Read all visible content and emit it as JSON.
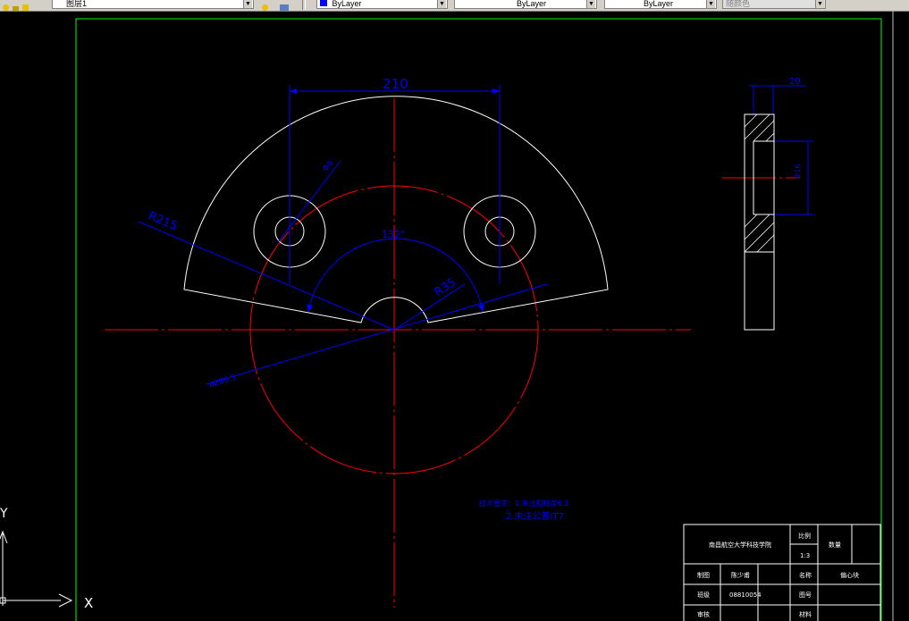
{
  "toolbar": {
    "layer_name": "图层1",
    "color_value": "ByLayer",
    "linetype_value": "ByLayer",
    "lineweight_value": "ByLayer",
    "plotstyle_value": "随颜色"
  },
  "drawing": {
    "dim_width": "210",
    "dim_hole": "Φ6",
    "dim_outer_radius": "R215",
    "dim_angle": "132°",
    "dim_inner_radius": "R35",
    "dim_dia": "ø286.5",
    "dim_side_thickness": "20",
    "dim_side_height": "Φ16",
    "tech_req_1": "技术要求：1.未注粗糙度6.3",
    "tech_req_2": "2.未注公差IT7"
  },
  "title_block": {
    "school": "南昌航空大学科技学院",
    "scale_label": "比例",
    "scale_value": "1:3",
    "qty_label": "数量",
    "drawn_label": "制图",
    "drawn_name": "陈少甫",
    "name_label": "名称",
    "part_name": "偏心块",
    "class_label": "班级",
    "class_value": "08810054",
    "drawing_no_label": "图号",
    "check_label": "审核",
    "material_label": "材料"
  },
  "ucs": {
    "x_label": "X",
    "y_label": "Y"
  }
}
